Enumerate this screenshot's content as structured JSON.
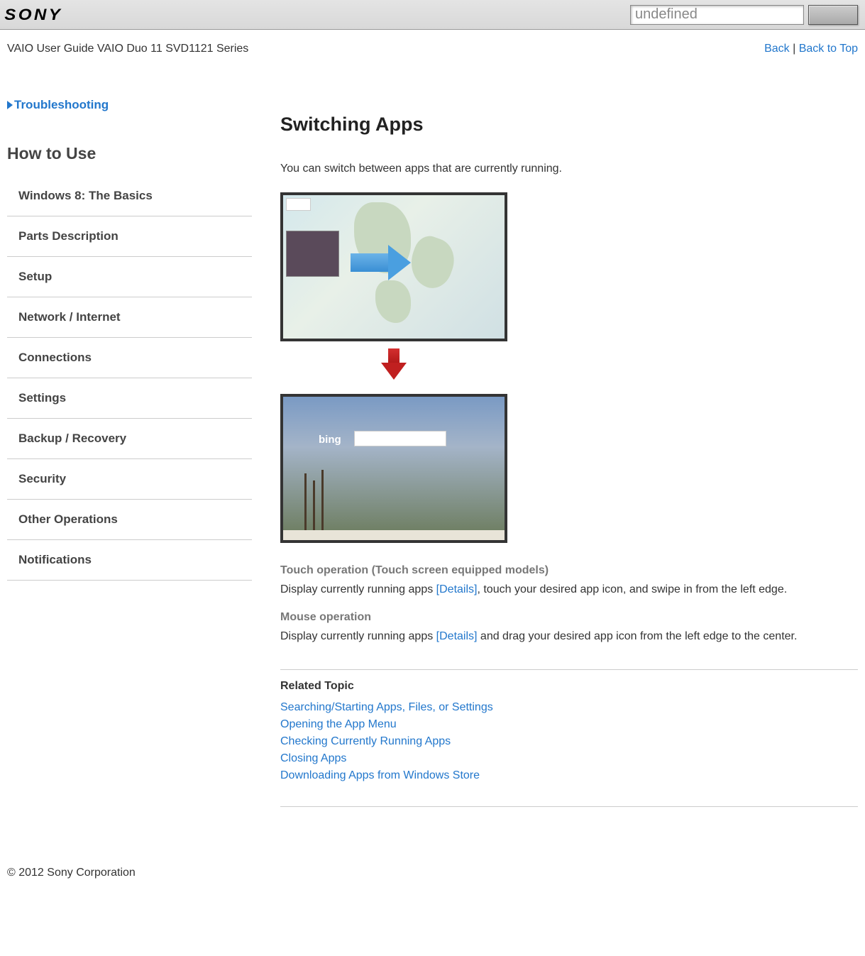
{
  "header": {
    "brand": "SONY",
    "search_value": "undefined"
  },
  "subheader": {
    "breadcrumb": "VAIO User Guide VAIO Duo 11 SVD1121 Series",
    "back_link": "Back",
    "separator": " | ",
    "back_to_top_link": "Back to Top"
  },
  "sidebar": {
    "troubleshooting": "Troubleshooting",
    "how_to_use": "How to Use",
    "items": [
      "Windows 8: The Basics",
      "Parts Description",
      "Setup",
      "Network / Internet",
      "Connections",
      "Settings",
      "Backup / Recovery",
      "Security",
      "Other Operations",
      "Notifications"
    ]
  },
  "main": {
    "title": "Switching Apps",
    "intro": "You can switch between apps that are currently running.",
    "illustration": {
      "bing_label": "bing"
    },
    "touch_heading": "Touch operation (Touch screen equipped models)",
    "touch_text_before": "Display currently running apps ",
    "touch_details": "[Details]",
    "touch_text_after": ", touch your desired app icon, and swipe in from the left edge.",
    "mouse_heading": "Mouse operation",
    "mouse_text_before": "Display currently running apps ",
    "mouse_details": "[Details]",
    "mouse_text_after": " and drag your desired app icon from the left edge to the center.",
    "related_heading": "Related Topic",
    "related_links": [
      "Searching/Starting Apps, Files, or Settings",
      "Opening the App Menu",
      "Checking Currently Running Apps",
      "Closing Apps",
      "Downloading Apps from Windows Store"
    ]
  },
  "footer": {
    "copyright": "© 2012 Sony Corporation"
  }
}
